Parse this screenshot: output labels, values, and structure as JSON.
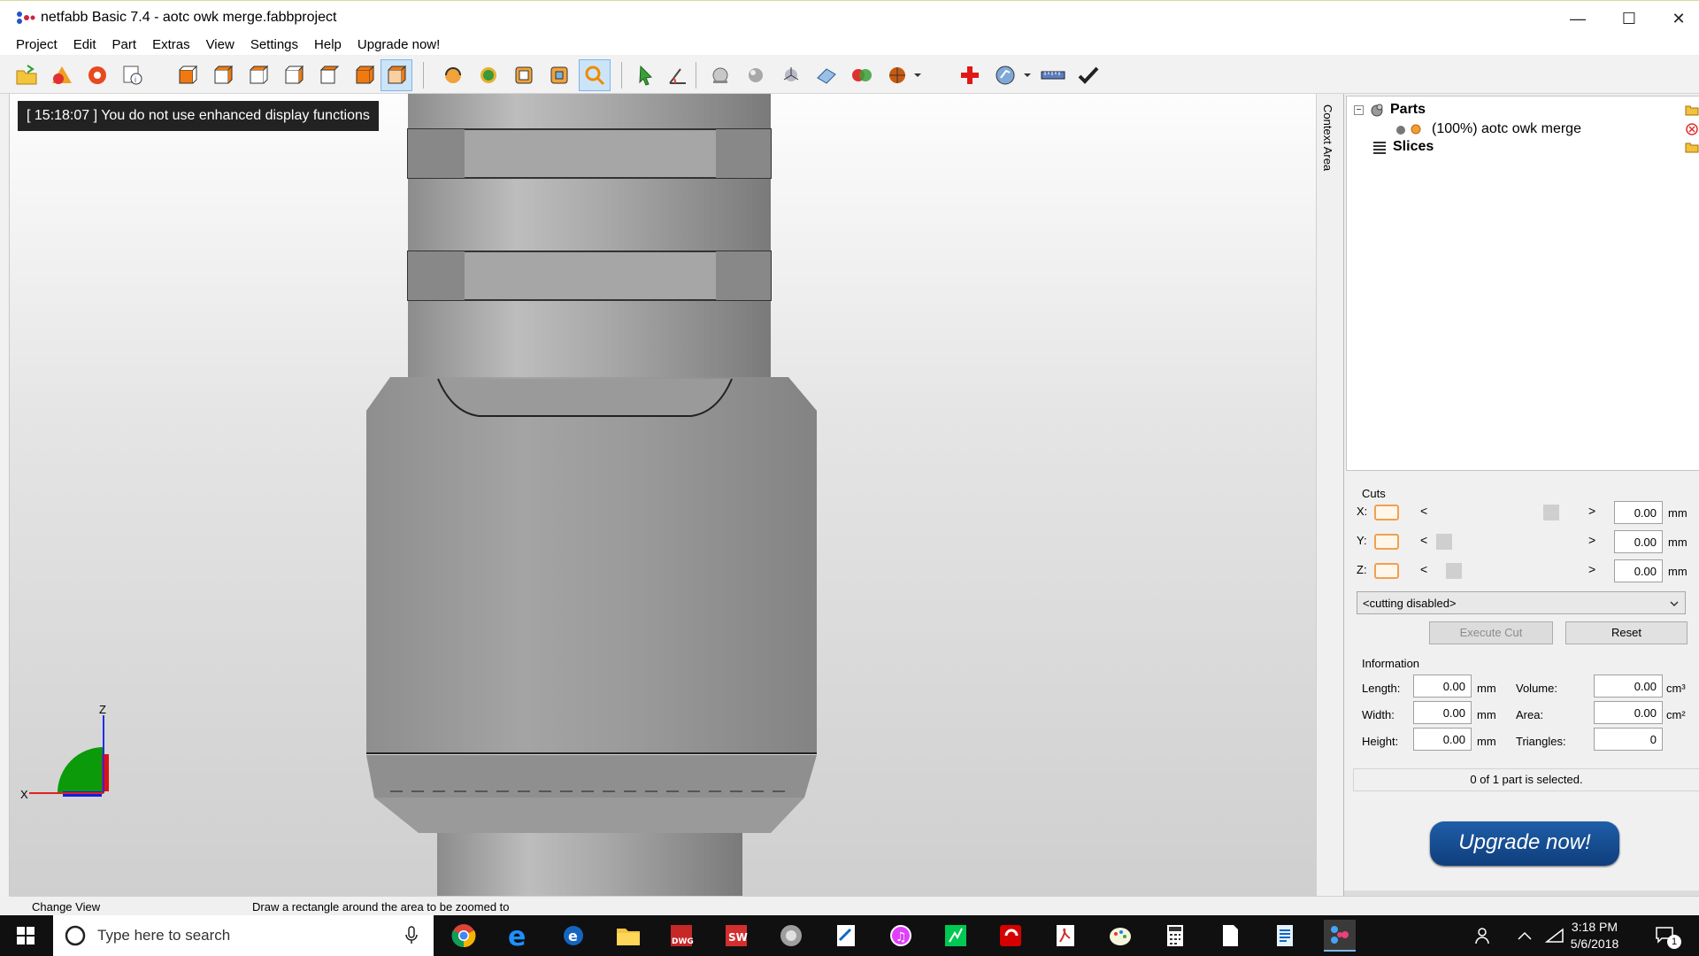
{
  "window": {
    "title": "netfabb Basic 7.4 - aotc owk merge.fabbproject"
  },
  "menu": [
    "Project",
    "Edit",
    "Part",
    "Extras",
    "View",
    "Settings",
    "Help",
    "Upgrade now!"
  ],
  "toolbar": {
    "buttons": [
      "open-project-icon",
      "add-part-icon",
      "repair-icon",
      "part-info-icon",
      "view-front-icon",
      "view-back-icon",
      "view-left-icon",
      "view-right-icon",
      "view-top-icon",
      "view-bottom-icon",
      "view-iso-icon",
      "rotate-view-icon",
      "pan-view-icon",
      "zoom-all-icon",
      "zoom-selection-icon",
      "zoom-rectangle-icon",
      "select-pointer-icon",
      "measure-angle-icon",
      "shading-icon",
      "smooth-shading-icon",
      "axes-icon",
      "wireframe-icon",
      "colors-icon",
      "texture-icon",
      "add-repair-icon",
      "fit-icon",
      "ruler-icon",
      "check-icon"
    ],
    "active": "zoom-rectangle-icon"
  },
  "viewport": {
    "message": "[ 15:18:07 ] You do not use enhanced display functions",
    "axes": {
      "z_label": "Z",
      "x_label": "X"
    }
  },
  "context_area": {
    "label": "Context Area"
  },
  "tree": {
    "parts_label": "Parts",
    "part_item": "(100%) aotc owk merge",
    "slices_label": "Slices"
  },
  "cuts": {
    "title": "Cuts",
    "axes": [
      {
        "label": "X:",
        "value": "0.00",
        "unit": "mm",
        "position": 0.85
      },
      {
        "label": "Y:",
        "value": "0.00",
        "unit": "mm",
        "position": 0.0
      },
      {
        "label": "Z:",
        "value": "0.00",
        "unit": "mm",
        "position": 0.08
      }
    ],
    "mode": "<cutting disabled>",
    "execute_label": "Execute Cut",
    "reset_label": "Reset"
  },
  "information": {
    "title": "Information",
    "length": {
      "label": "Length:",
      "value": "0.00",
      "unit": "mm"
    },
    "width": {
      "label": "Width:",
      "value": "0.00",
      "unit": "mm"
    },
    "height": {
      "label": "Height:",
      "value": "0.00",
      "unit": "mm"
    },
    "volume": {
      "label": "Volume:",
      "value": "0.00",
      "unit": "cm³"
    },
    "area": {
      "label": "Area:",
      "value": "0.00",
      "unit": "cm²"
    },
    "triangles": {
      "label": "Triangles:",
      "value": "0"
    }
  },
  "selection_status": "0 of 1 part is selected.",
  "upgrade_label": "Upgrade now!",
  "statusbar": {
    "left": "Change View",
    "hint": "Draw a rectangle around the area to be zoomed to"
  },
  "taskbar": {
    "search_placeholder": "Type here to search",
    "apps": [
      "chrome-icon",
      "edge-icon",
      "ie-icon",
      "file-explorer-icon",
      "dwg-icon",
      "sw-icon",
      "app-icon",
      "notepad-icon",
      "itunes-icon",
      "app-green-icon",
      "app-red-icon",
      "acrobat-icon",
      "paint-icon",
      "calculator-icon",
      "file-icon",
      "document-icon",
      "netfabb-icon"
    ],
    "time": "3:18 PM",
    "date": "5/6/2018",
    "notifications": "1"
  }
}
